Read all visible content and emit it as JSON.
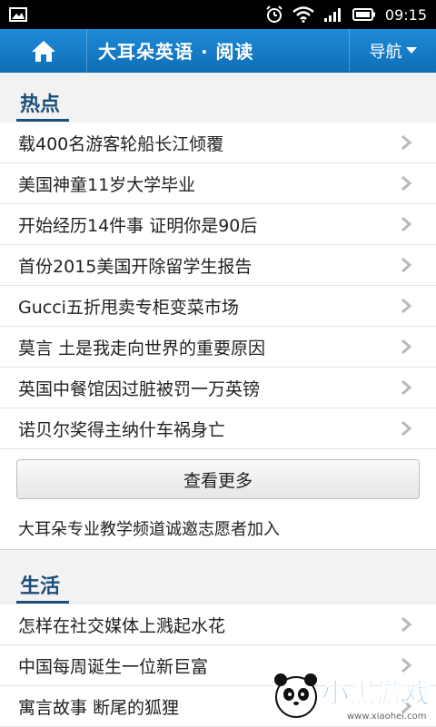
{
  "status_bar": {
    "time": "09:15",
    "icons": [
      "image-icon",
      "alarm-icon",
      "wifi-icon",
      "signal-icon",
      "battery-icon"
    ]
  },
  "header": {
    "title": "大耳朵英语 · 阅读",
    "nav_label": "导航",
    "home_icon": "home-icon",
    "colors": {
      "bar": "#1683cf",
      "title_text": "#ffffff"
    }
  },
  "hot": {
    "title": "热点",
    "items": [
      "载400名游客轮船长江倾覆",
      "美国神童11岁大学毕业",
      "开始经历14件事 证明你是90后",
      "首份2015美国开除留学生报告",
      "Gucci五折甩卖专柜变菜市场",
      "莫言 土是我走向世界的重要原因",
      "英国中餐馆因过脏被罚一万英镑",
      "诺贝尔奖得主纳什车祸身亡"
    ],
    "more_label": "查看更多",
    "recruit_text": "大耳朵专业教学频道诚邀志愿者加入"
  },
  "life": {
    "title": "生活",
    "items": [
      "怎样在社交媒体上溅起水花",
      "中国每周诞生一位新巨富",
      "寓言故事 断尾的狐狸"
    ]
  },
  "watermark": {
    "text": "小黑游戏",
    "url": "www.xiaohei.com"
  }
}
